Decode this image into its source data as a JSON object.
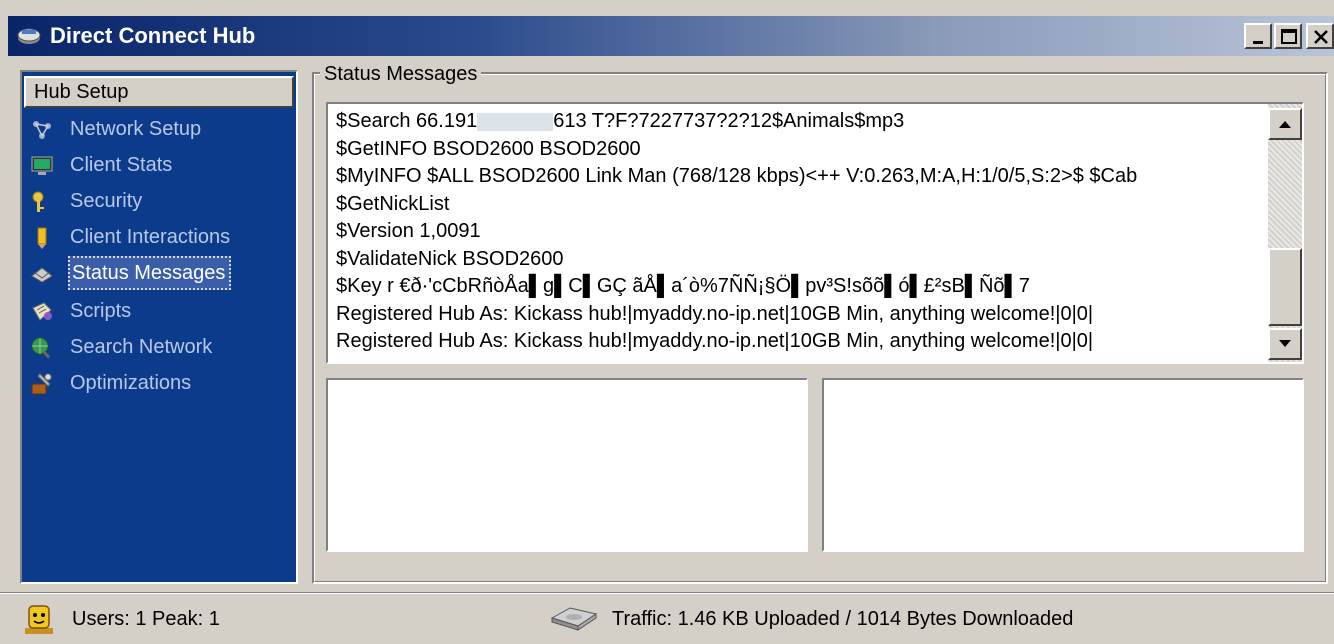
{
  "window": {
    "title": "Direct Connect Hub",
    "icon": "hub-app-icon",
    "controls": [
      "minimize",
      "maximize",
      "close"
    ]
  },
  "nav": {
    "header": "Hub Setup",
    "items": [
      {
        "label": "Network Setup",
        "icon": "network-icon"
      },
      {
        "label": "Client Stats",
        "icon": "monitor-icon"
      },
      {
        "label": "Security",
        "icon": "keys-icon"
      },
      {
        "label": "Client Interactions",
        "icon": "pencil-icon"
      },
      {
        "label": "Status Messages",
        "icon": "envelope-icon",
        "selected": true
      },
      {
        "label": "Scripts",
        "icon": "scroll-icon"
      },
      {
        "label": "Search Network",
        "icon": "globe-search-icon"
      },
      {
        "label": "Optimizations",
        "icon": "tools-icon"
      }
    ]
  },
  "status_group": {
    "title": "Status Messages",
    "log_lines": [
      {
        "pre": "$Search 66.191",
        "post": "613 T?F?7227737?2?12$Animals$mp3",
        "redacted": true
      },
      {
        "pre": "$GetINFO BSOD2600 BSOD2600"
      },
      {
        "pre": "$MyINFO $ALL BSOD2600 Link Man (768/128 kbps)<++ V:0.263,M:A,H:1/0/5,S:2>$ $Cab"
      },
      {
        "pre": "$GetNickList"
      },
      {
        "pre": "$Version 1,0091"
      },
      {
        "pre": "$ValidateNick BSOD2600"
      },
      {
        "pre": "$Key r €ð·'cCbRñòÅa▌g▌C▌GÇ ãÅ▌a´ò%7ÑÑ¡§Ö▌pv³S!sõõ▌ó▌£²sB▌Ñõ▌7"
      },
      {
        "pre": "Registered Hub As: Kickass hub!|myaddy.no-ip.net|10GB Min, anything welcome!|0|0|"
      },
      {
        "pre": "Registered Hub As: Kickass hub!|myaddy.no-ip.net|10GB Min, anything welcome!|0|0|"
      }
    ]
  },
  "statusbar": {
    "users": "Users: 1 Peak: 1",
    "traffic": "Traffic: 1.46 KB Uploaded  /  1014 Bytes Downloaded"
  },
  "colors": {
    "titlebar_start": "#0a246a",
    "nav_background": "#0d3b8c",
    "window_face": "#d4d0c8"
  }
}
